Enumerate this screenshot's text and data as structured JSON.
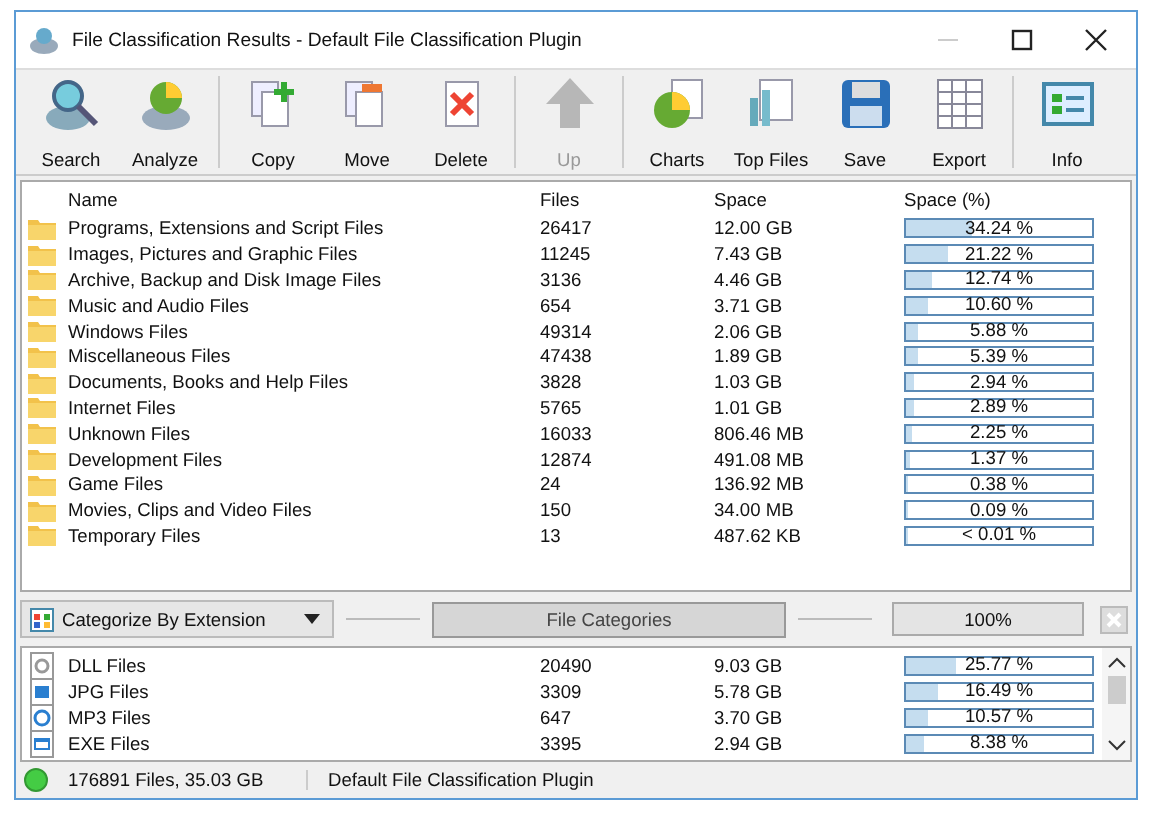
{
  "window": {
    "title": "File Classification Results - Default File Classification Plugin"
  },
  "toolbar": [
    {
      "label": "Search",
      "disabled": false
    },
    {
      "label": "Analyze",
      "disabled": false
    },
    {
      "label": "Copy",
      "disabled": false
    },
    {
      "label": "Move",
      "disabled": false
    },
    {
      "label": "Delete",
      "disabled": false
    },
    {
      "label": "Up",
      "disabled": true
    },
    {
      "label": "Charts",
      "disabled": false
    },
    {
      "label": "Top Files",
      "disabled": false
    },
    {
      "label": "Save",
      "disabled": false
    },
    {
      "label": "Export",
      "disabled": false
    },
    {
      "label": "Info",
      "disabled": false
    }
  ],
  "table": {
    "columns": [
      "Name",
      "Files",
      "Space",
      "Space (%)"
    ],
    "rows": [
      {
        "name": "Programs, Extensions and Script Files",
        "files": "26417",
        "space": "12.00 GB",
        "percent": "34.24 %",
        "level": 0.3424
      },
      {
        "name": "Images, Pictures and Graphic Files",
        "files": "11245",
        "space": "7.43 GB",
        "percent": "21.22 %",
        "level": 0.2122
      },
      {
        "name": "Archive, Backup and Disk Image Files",
        "files": "3136",
        "space": "4.46 GB",
        "percent": "12.74 %",
        "level": 0.1274
      },
      {
        "name": "Music and Audio Files",
        "files": "654",
        "space": "3.71 GB",
        "percent": "10.60 %",
        "level": 0.106
      },
      {
        "name": "Windows Files",
        "files": "49314",
        "space": "2.06 GB",
        "percent": "5.88 %",
        "level": 0.0588
      },
      {
        "name": "Miscellaneous Files",
        "files": "47438",
        "space": "1.89 GB",
        "percent": "5.39 %",
        "level": 0.0539
      },
      {
        "name": "Documents, Books and Help Files",
        "files": "3828",
        "space": "1.03 GB",
        "percent": "2.94 %",
        "level": 0.0294
      },
      {
        "name": "Internet Files",
        "files": "5765",
        "space": "1.01 GB",
        "percent": "2.89 %",
        "level": 0.0289
      },
      {
        "name": "Unknown Files",
        "files": "16033",
        "space": "806.46 MB",
        "percent": "2.25 %",
        "level": 0.0225
      },
      {
        "name": "Development Files",
        "files": "12874",
        "space": "491.08 MB",
        "percent": "1.37 %",
        "level": 0.0137
      },
      {
        "name": "Game Files",
        "files": "24",
        "space": "136.92 MB",
        "percent": "0.38 %",
        "level": 0.0038
      },
      {
        "name": "Movies, Clips and Video Files",
        "files": "150",
        "space": "34.00 MB",
        "percent": "0.09 %",
        "level": 0.0009
      },
      {
        "name": "Temporary Files",
        "files": "13",
        "space": "487.62 KB",
        "percent": "< 0.01 %",
        "level": 0.0001
      }
    ]
  },
  "midbar": {
    "categorize": "Categorize By Extension",
    "categories_button": "File Categories",
    "progress": {
      "text": "100%",
      "level": 1
    }
  },
  "details": {
    "rows": [
      {
        "name": "DLL Files",
        "files": "20490",
        "space": "9.03 GB",
        "percent": "25.77 %",
        "level": 0.2577
      },
      {
        "name": "JPG Files",
        "files": "3309",
        "space": "5.78 GB",
        "percent": "16.49 %",
        "level": 0.1649
      },
      {
        "name": "MP3 Files",
        "files": "647",
        "space": "3.70 GB",
        "percent": "10.57 %",
        "level": 0.1057
      },
      {
        "name": "EXE Files",
        "files": "3395",
        "space": "2.94 GB",
        "percent": "8.38 %",
        "level": 0.0838
      }
    ]
  },
  "status_bar": {
    "summary": "176891 Files, 35.03 GB",
    "plugin": "Default File Classification Plugin"
  }
}
